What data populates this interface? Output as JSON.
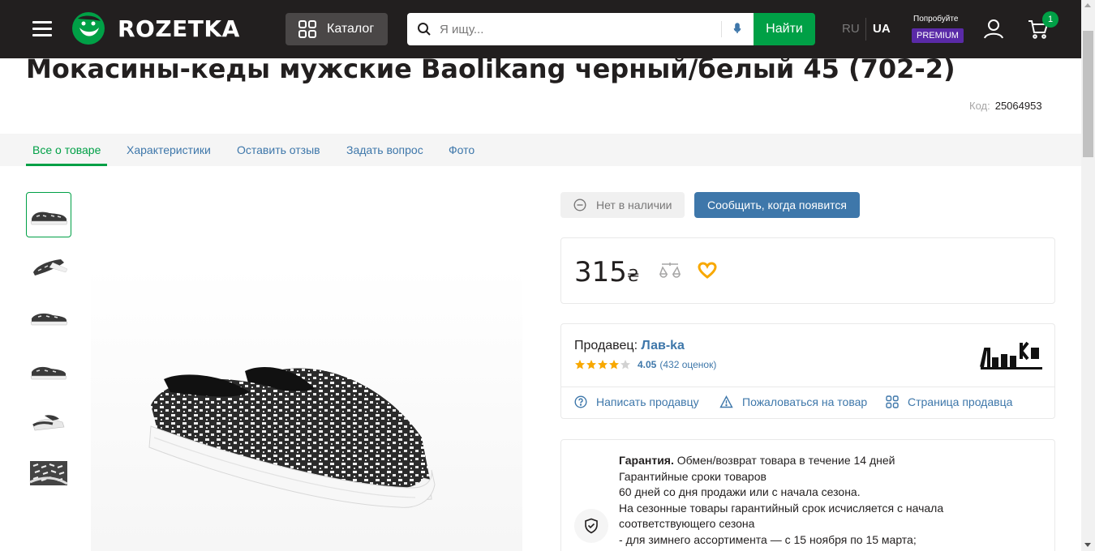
{
  "header": {
    "logo_text": "ROZETKA",
    "catalog_label": "Каталог",
    "search_placeholder": "Я ищу...",
    "search_button": "Найти",
    "lang_ru": "RU",
    "lang_ua": "UA",
    "try_label": "Попробуйте",
    "premium_label": "PREMIUM",
    "cart_count": "1",
    "colors": {
      "bg": "#221f1f",
      "green": "#00a046",
      "premium": "#5a2aa7"
    }
  },
  "product": {
    "title": "Мокасины-кеды мужские Baolikang черный/белый 45 (702-2)",
    "code_label": "Код:",
    "code_value": "25064953"
  },
  "tabs": [
    {
      "label": "Все о товаре",
      "active": true
    },
    {
      "label": "Характеристики",
      "active": false
    },
    {
      "label": "Оставить отзыв",
      "active": false
    },
    {
      "label": "Задать вопрос",
      "active": false
    },
    {
      "label": "Фото",
      "active": false
    }
  ],
  "availability": {
    "status": "Нет в наличии",
    "notify_button": "Сообщить, когда появится"
  },
  "price": {
    "amount": "315",
    "currency": "₴"
  },
  "seller": {
    "label": "Продавец:",
    "name": "Лав-ka",
    "rating": "4.05",
    "reviews": "(432 оценок)",
    "stars_filled": 4,
    "logo_text": "ЛавКа",
    "links": {
      "write": "Написать продавцу",
      "complain": "Пожаловаться на товар",
      "page": "Страница продавца"
    }
  },
  "warranty": {
    "title": "Гарантия.",
    "line1": "Обмен/возврат товара в течение 14 дней",
    "line2": "Гарантийные сроки товаров",
    "line3": "60 дней со дня продажи или с начала сезона.",
    "line4": "На сезонные товары гарантийный срок исчисляется с начала",
    "line5": "соответствующего сезона",
    "line6": "- для зимнего ассортимента — с 15 ноября по 15 марта;"
  },
  "icons": {
    "menu": "menu-icon",
    "catalog": "grid-icon",
    "search": "search-icon",
    "mic": "microphone-icon",
    "user": "user-icon",
    "cart": "cart-icon",
    "compare": "scales-icon",
    "favorite": "heart-icon",
    "unavailable": "minus-circle-icon",
    "question": "question-circle-icon",
    "warning": "warning-icon",
    "shop": "grid-icon",
    "warranty": "shield-check-icon"
  }
}
